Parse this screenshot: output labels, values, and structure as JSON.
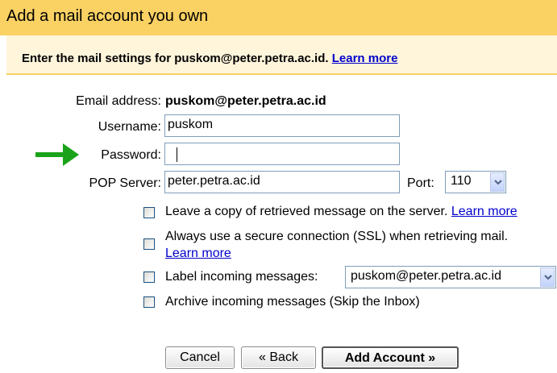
{
  "header": {
    "title": "Add a mail account you own"
  },
  "subheader": {
    "text": "Enter the mail settings for puskom@peter.petra.ac.id.",
    "learn_more": "Learn more"
  },
  "form": {
    "email_label": "Email address:",
    "email_value": "puskom@peter.petra.ac.id",
    "username_label": "Username:",
    "username_value": "puskom",
    "password_label": "Password:",
    "password_value": "",
    "pop_label": "POP Server:",
    "pop_value": "peter.petra.ac.id",
    "port_label": "Port:",
    "port_value": "110"
  },
  "options": {
    "leave_copy": {
      "text": "Leave a copy of retrieved message on the server.",
      "link": "Learn more",
      "checked": false
    },
    "ssl": {
      "text": "Always use a secure connection (SSL) when retrieving mail.",
      "link": "Learn more",
      "checked": false
    },
    "label_incoming": {
      "text": "Label incoming messages:",
      "value": "puskom@peter.petra.ac.id",
      "checked": false
    },
    "archive": {
      "text": "Archive incoming messages (Skip the Inbox)",
      "checked": false
    }
  },
  "buttons": {
    "cancel": "Cancel",
    "back": "« Back",
    "add_account": "Add Account »"
  },
  "colors": {
    "header_bg": "#fad163",
    "subheader_bg": "#fef5db",
    "link": "#0000cc",
    "arrow": "#1aa31a"
  },
  "icons": {
    "pointer_arrow": "green-right-arrow",
    "dropdown": "chevron-down-icon"
  }
}
